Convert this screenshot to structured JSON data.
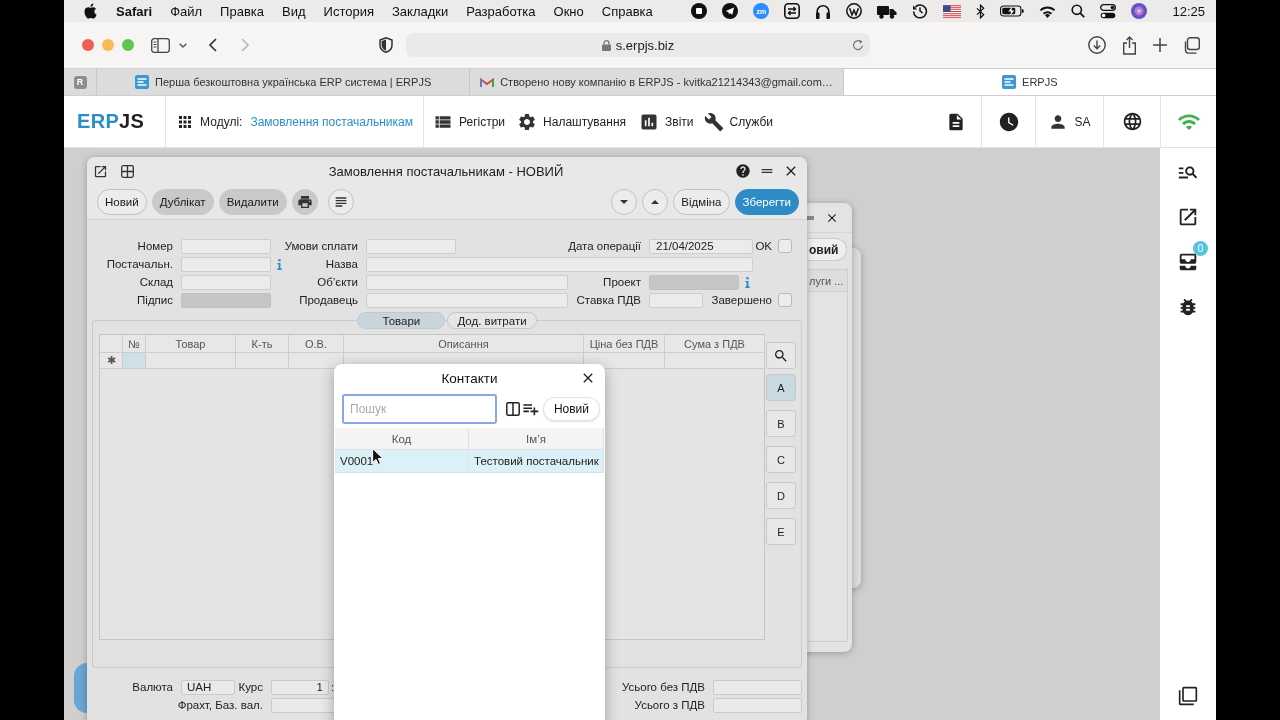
{
  "menu_bar": {
    "app_name": "Safari",
    "menus": [
      "Файл",
      "Правка",
      "Вид",
      "История",
      "Закладки",
      "Разработка",
      "Окно",
      "Справка"
    ],
    "status_badge": "zm",
    "clock": "12:25"
  },
  "browser": {
    "address": "s.erpjs.biz",
    "tabs": [
      {
        "kind": "pinned",
        "label": "R",
        "selected": false
      },
      {
        "kind": "page",
        "label": "Перша безкоштовна українська ERP система | ERPJS",
        "selected": false
      },
      {
        "kind": "mail",
        "label": "Створено нову компанію в ERPJS - kvitka21214343@gmail.com…",
        "selected": false
      },
      {
        "kind": "page",
        "label": "ERPJS",
        "selected": true
      }
    ]
  },
  "app_header": {
    "logo": {
      "part_1": "ERP",
      "part_2": "JS"
    },
    "modules_label": "Модулі:",
    "current_module": "Замовлення постачальникам",
    "nav": [
      "Регістри",
      "Налаштування",
      "Звіти",
      "Служби"
    ],
    "user": "SA"
  },
  "order_window": {
    "title": "Замовлення постачальникам - НОВИЙ",
    "toolbar_left": [
      {
        "kind": "text",
        "label": "Новий",
        "disabled": false
      },
      {
        "kind": "text",
        "label": "Дублікат",
        "disabled": true
      },
      {
        "kind": "text",
        "label": "Видалити",
        "disabled": true
      },
      {
        "kind": "print",
        "disabled": true
      },
      {
        "kind": "menu",
        "disabled": false
      }
    ],
    "toolbar_right": [
      {
        "kind": "down"
      },
      {
        "kind": "up"
      },
      {
        "kind": "text",
        "label": "Відміна"
      },
      {
        "kind": "primary",
        "label": "Зберегти"
      }
    ],
    "form": [
      {
        "cells": [
          {
            "kind": "field",
            "label": "Номер",
            "disabled": false
          },
          {
            "kind": "field",
            "label": "Умови сплати",
            "disabled": false
          },
          {
            "kind": "field",
            "label": "Дата операції",
            "value": "21/04/2025",
            "disabled": false
          },
          {
            "kind": "checkbox",
            "label": "OK",
            "checked": false,
            "disabled": false
          }
        ]
      },
      {
        "cells": [
          {
            "kind": "lookup",
            "label": "Постачальн.",
            "disabled": false
          },
          {
            "kind": "field",
            "label": "Назва",
            "disabled": false
          }
        ]
      },
      {
        "cells": [
          {
            "kind": "field",
            "label": "Склад",
            "disabled": false
          },
          {
            "kind": "field",
            "label": "Об’єкти",
            "disabled": false
          },
          {
            "kind": "lookup",
            "label": "Проект",
            "disabled": true
          }
        ]
      },
      {
        "cells": [
          {
            "kind": "field",
            "label": "Підпис",
            "disabled": true
          },
          {
            "kind": "field",
            "label": "Продавець",
            "disabled": false
          },
          {
            "kind": "field",
            "label": "Ставка ПДВ",
            "disabled": false
          },
          {
            "kind": "checkbox",
            "label": "Завершено",
            "checked": false,
            "disabled": false
          }
        ]
      }
    ],
    "tabs": [
      {
        "label": "Товари",
        "selected": true
      },
      {
        "label": "Дод. витрати",
        "selected": false
      }
    ],
    "table": {
      "columns": [
        "№",
        "Товар",
        "К-ть",
        "О.В.",
        "Описання",
        "Ціна без ПДВ",
        "Сума з ПДВ"
      ],
      "new_row": {
        "marker": "✱",
        "cells": [
          {
            "selected": true
          },
          {
            "selected": false
          },
          {
            "selected": false
          },
          {
            "selected": false
          },
          {
            "selected": false
          },
          {
            "selected": false
          },
          {
            "selected": false
          }
        ]
      }
    },
    "letters": [
      {
        "label": "A",
        "selected": true
      },
      {
        "label": "B",
        "selected": false
      },
      {
        "label": "C",
        "selected": false
      },
      {
        "label": "D",
        "selected": false
      },
      {
        "label": "E",
        "selected": false
      }
    ],
    "footer": {
      "currency_label": "Валюта",
      "currency": "UAH",
      "rate_label": "Курс",
      "rate": "1",
      "rate_separator": ":",
      "freight_label": "Фрахт, Баз. вал.",
      "totals": [
        "Усього без ПДВ",
        "Усього з ПДВ"
      ]
    }
  },
  "background_window": {
    "button": "овий",
    "tab": "луги ..."
  },
  "contacts_dialog": {
    "title": "Контакти",
    "search": {
      "placeholder": "Пошук",
      "focused": true
    },
    "new_button": "Новий",
    "columns": [
      "Код",
      "Ім’я"
    ],
    "rows": [
      {
        "cells": [
          "V0001",
          "Тестовий постачальник"
        ],
        "selected": true
      }
    ]
  },
  "sidebar": {
    "inbox_count": "0"
  }
}
